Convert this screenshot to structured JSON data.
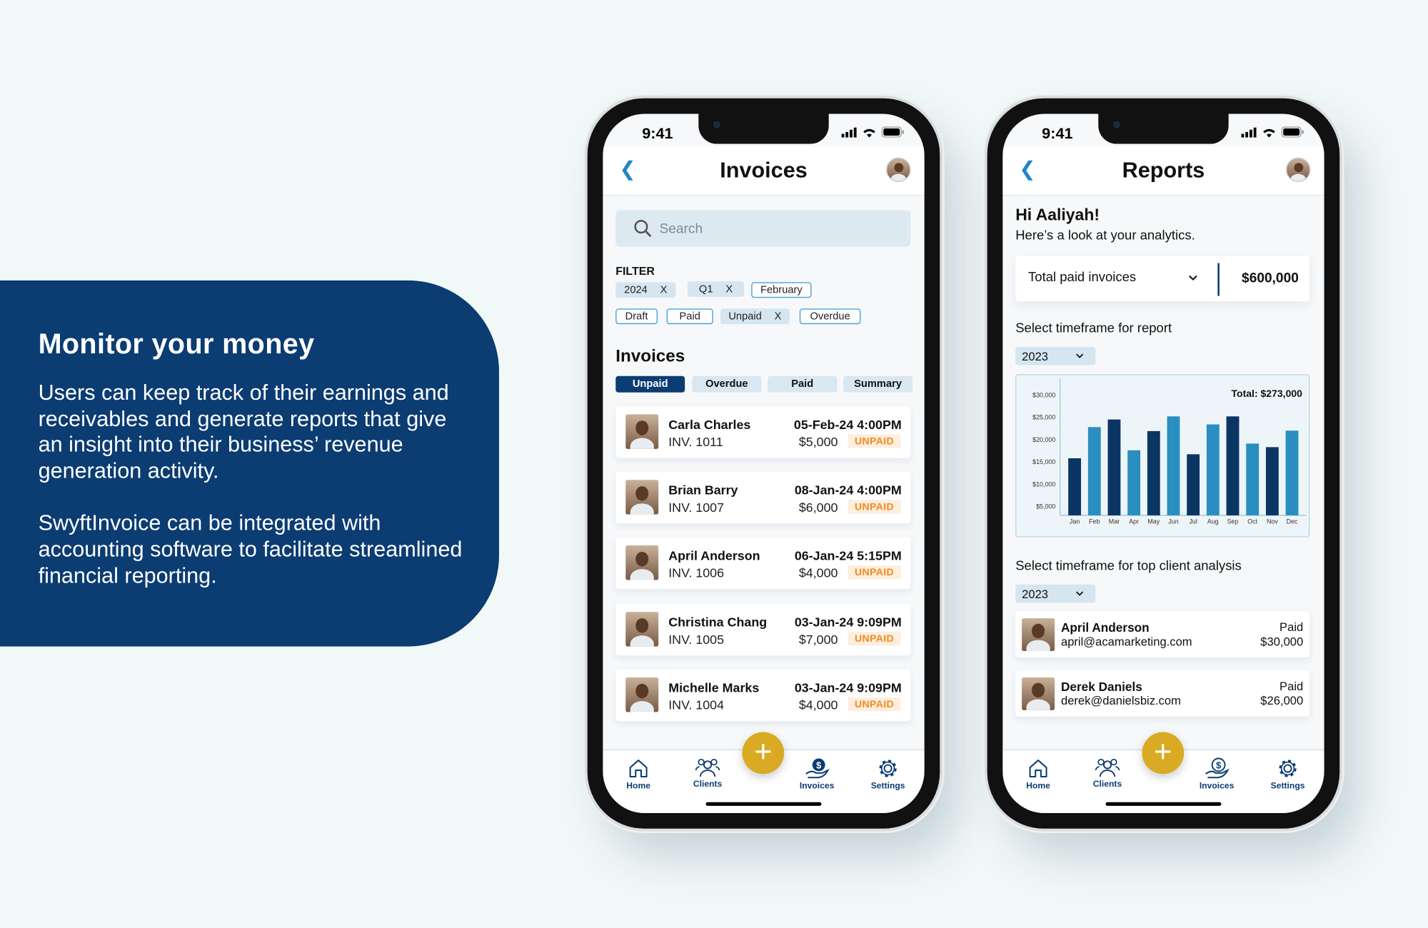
{
  "promo": {
    "heading": "Monitor your money",
    "paragraphs": [
      "Users can keep track of their earnings and receivables and generate reports that give an insight into their business’ revenue generation activity.",
      "SwyftInvoice can be integrated with accounting software to facilitate streamlined financial reporting."
    ]
  },
  "status_bar": {
    "time": "9:41"
  },
  "invoices_screen": {
    "title": "Invoices",
    "search": {
      "placeholder": "Search",
      "value": ""
    },
    "filter_label": "FILTER",
    "filter_chips": [
      {
        "label": "2024",
        "selected": true,
        "remove": "X"
      },
      {
        "label": "Q1",
        "selected": true,
        "remove": "X"
      },
      {
        "label": "February",
        "selected": false
      },
      {
        "label": "Draft",
        "selected": false
      },
      {
        "label": "Paid",
        "selected": false
      },
      {
        "label": "Unpaid",
        "selected": true,
        "remove": "X"
      },
      {
        "label": "Overdue",
        "selected": false
      }
    ],
    "section_title": "Invoices",
    "tabs": [
      {
        "label": "Unpaid",
        "active": true
      },
      {
        "label": "Overdue"
      },
      {
        "label": "Paid"
      },
      {
        "label": "Summary"
      }
    ],
    "invoices": [
      {
        "name": "Carla Charles",
        "number": "INV. 1011",
        "date": "05-Feb-24 4:00PM",
        "amount": "$5,000",
        "status": "UNPAID"
      },
      {
        "name": "Brian Barry",
        "number": "INV. 1007",
        "date": "08-Jan-24 4:00PM",
        "amount": "$6,000",
        "status": "UNPAID"
      },
      {
        "name": "April Anderson",
        "number": "INV. 1006",
        "date": "06-Jan-24 5:15PM",
        "amount": "$4,000",
        "status": "UNPAID"
      },
      {
        "name": "Christina Chang",
        "number": "INV. 1005",
        "date": "03-Jan-24 9:09PM",
        "amount": "$7,000",
        "status": "UNPAID"
      },
      {
        "name": "Michelle Marks",
        "number": "INV. 1004",
        "date": "03-Jan-24 9:09PM",
        "amount": "$4,000",
        "status": "UNPAID"
      }
    ]
  },
  "reports_screen": {
    "title": "Reports",
    "greeting": "Hi Aaliyah!",
    "subtitle": "Here’s a look at your analytics.",
    "metric_select": "Total paid invoices",
    "metric_value": "$600,000",
    "report_timeframe_label": "Select timeframe for report",
    "report_year": "2023",
    "client_timeframe_label": "Select timeframe for top client analysis",
    "client_year": "2023",
    "top_clients": [
      {
        "name": "April Anderson",
        "email": "april@acamarketing.com",
        "status": "Paid",
        "amount": "$30,000"
      },
      {
        "name": "Derek Daniels",
        "email": "derek@danielsbiz.com",
        "status": "Paid",
        "amount": "$26,000"
      }
    ]
  },
  "nav": {
    "items": [
      "Home",
      "Clients",
      "Invoices",
      "Settings"
    ],
    "fab": "+"
  },
  "colors": {
    "brand": "#0b3c72",
    "accent": "#1f86c6",
    "fab": "#d9aa22",
    "unpaid": "#f28a1e",
    "bar_dark": "#0b3563",
    "bar_light": "#2a8fc0"
  },
  "chart_data": {
    "type": "bar",
    "annotation": "Total: $273,000",
    "categories": [
      "Jan",
      "Feb",
      "Mar",
      "Apr",
      "May",
      "Jun",
      "Jul",
      "Aug",
      "Sep",
      "Oct",
      "Nov",
      "Dec"
    ],
    "values": [
      15800,
      22800,
      24500,
      17600,
      21900,
      25200,
      16700,
      23400,
      25200,
      19100,
      18300,
      22000
    ],
    "yticks": [
      "$5,000",
      "$10,000",
      "$15,000",
      "$20,000",
      "$25,000",
      "$30,000"
    ],
    "ytick_values": [
      5000,
      10000,
      15000,
      20000,
      25000,
      30000
    ],
    "ylim": [
      3000,
      32000
    ],
    "grid": false
  }
}
